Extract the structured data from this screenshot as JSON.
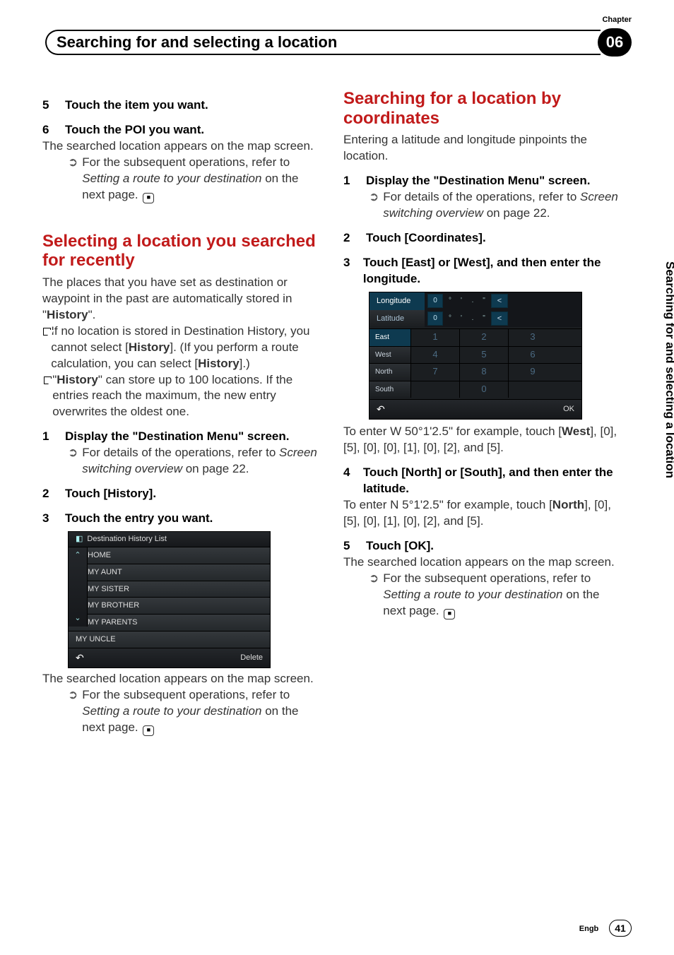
{
  "header": {
    "chapter_label": "Chapter",
    "title": "Searching for and selecting a location",
    "chapter_number": "06"
  },
  "side_tab": "Searching for and selecting a location",
  "footer": {
    "lang": "Engb",
    "page": "41"
  },
  "left": {
    "step5": {
      "num": "5",
      "text": "Touch the item you want."
    },
    "step6": {
      "num": "6",
      "title": "Touch the POI you want.",
      "body": "The searched location appears on the map screen.",
      "note_pre": "For the subsequent operations, refer to ",
      "note_link": "Setting a route to your destination",
      "note_post": " on the next page."
    },
    "sec_title": "Selecting a location you searched for recently",
    "intro_pre": "The places that you have set as destination or waypoint in the past are automatically stored in \"",
    "intro_bold": "History",
    "intro_post": "\".",
    "bul1_pre": "If no location is stored in Destination History, you cannot select [",
    "bul1_bold1": "History",
    "bul1_mid": "]. (If you perform a route calculation, you can select [",
    "bul1_bold2": "History",
    "bul1_post": "].)",
    "bul2_pre": "\"",
    "bul2_bold": "History",
    "bul2_post": "\" can store up to 100 locations. If the entries reach the maximum, the new entry overwrites the oldest one.",
    "l_step1": {
      "num": "1",
      "title": "Display the \"Destination Menu\" screen.",
      "note_pre": "For details of the operations, refer to ",
      "note_link": "Screen switching overview",
      "note_post": " on page 22."
    },
    "l_step2": {
      "num": "2",
      "title": "Touch [History]."
    },
    "l_step3": {
      "num": "3",
      "title": "Touch the entry you want."
    },
    "ui_history": {
      "title": "Destination History List",
      "items": [
        "HOME",
        "MY AUNT",
        "MY SISTER",
        "MY BROTHER",
        "MY PARENTS",
        "MY UNCLE"
      ],
      "delete": "Delete"
    },
    "after_ui": {
      "body": "The searched location appears on the map screen.",
      "note_pre": "For the subsequent operations, refer to ",
      "note_link": "Setting a route to your destination",
      "note_post": " on the next page."
    }
  },
  "right": {
    "sec_title": "Searching for a location by coordinates",
    "intro": "Entering a latitude and longitude pinpoints the location.",
    "r_step1": {
      "num": "1",
      "title": "Display the \"Destination Menu\" screen.",
      "note_pre": "For details of the operations, refer to ",
      "note_link": "Screen switching overview",
      "note_post": " on page 22."
    },
    "r_step2": {
      "num": "2",
      "title": "Touch [Coordinates]."
    },
    "r_step3": {
      "num": "3",
      "title": "Touch [East] or [West], and then enter the longitude."
    },
    "kp": {
      "row_lon": "Longitude",
      "row_lat": "Latitude",
      "sides": [
        "East",
        "West",
        "North",
        "South"
      ],
      "keys": [
        [
          "1",
          "2",
          "3"
        ],
        [
          "4",
          "5",
          "6"
        ],
        [
          "7",
          "8",
          "9"
        ],
        [
          "",
          "0",
          ""
        ]
      ],
      "slots": [
        "0",
        "°",
        "'",
        ".",
        "\"",
        "<"
      ],
      "ok": "OK"
    },
    "after_kp_pre": "To enter W 50°1'2.5\" for example, touch [",
    "after_kp_bold": "West",
    "after_kp_post": "], [0], [5], [0], [0], [1], [0], [2], and [5].",
    "r_step4": {
      "num": "4",
      "title": "Touch [North] or [South], and then enter the latitude.",
      "body_pre": "To enter N 5°1'2.5\" for example, touch [",
      "body_bold": "North",
      "body_post": "], [0], [5], [0], [1], [0], [2], and [5]."
    },
    "r_step5": {
      "num": "5",
      "title": "Touch [OK].",
      "body": "The searched location appears on the map screen.",
      "note_pre": "For the subsequent operations, refer to ",
      "note_link": "Setting a route to your destination",
      "note_post": " on the next page."
    }
  }
}
